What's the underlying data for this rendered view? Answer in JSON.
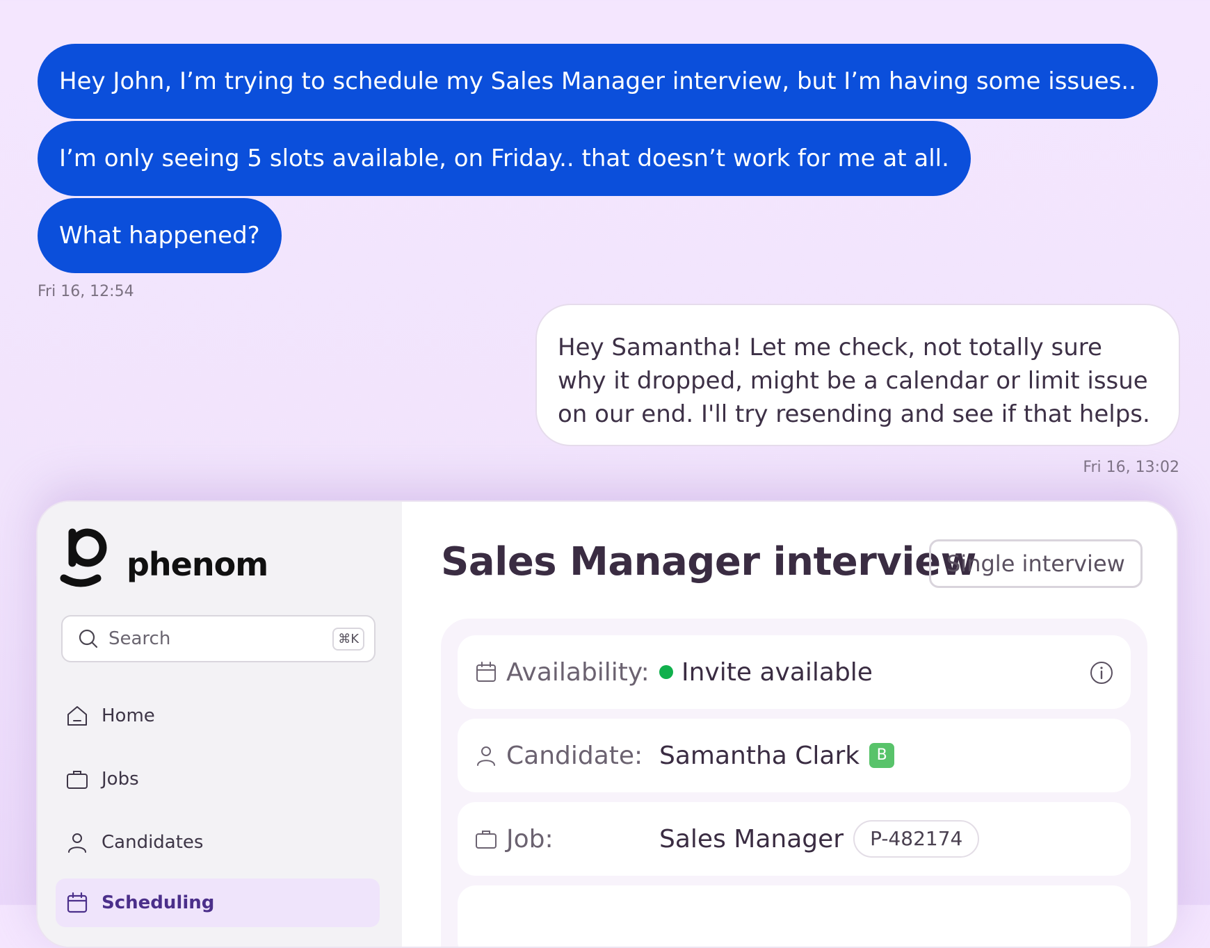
{
  "chat": {
    "incoming": [
      "Hey John, I’m trying to schedule my Sales Manager interview, but I’m having some issues..",
      "I’m only seeing 5 slots available, on Friday.. that doesn’t work for me at all.",
      "What happened?"
    ],
    "incoming_time": "Fri 16, 12:54",
    "outgoing": "Hey Samantha! Let me check, not totally sure why it dropped, might be a calendar or limit issue on our end. I'll try resending and see if that helps.",
    "outgoing_time": "Fri 16, 13:02"
  },
  "app": {
    "brand": "phenom",
    "search": {
      "placeholder": "Search",
      "shortcut": "⌘K"
    },
    "nav": {
      "home": "Home",
      "jobs": "Jobs",
      "candidates": "Candidates",
      "scheduling": "Scheduling"
    },
    "page_title": "Sales Manager interview",
    "interview_type": "Single interview",
    "details": {
      "availability_label": "Availability:",
      "availability_value": "Invite available",
      "candidate_label": "Candidate:",
      "candidate_value": "Samantha Clark",
      "candidate_tag": "B",
      "job_label": "Job:",
      "job_value": "Sales Manager",
      "job_id": "P-482174"
    }
  },
  "colors": {
    "incoming_bubble": "#0b4fdb",
    "status_available": "#10b04c",
    "candidate_tag": "#58c36a",
    "nav_active_bg": "#efe4fb"
  },
  "icons": {
    "search": "search-icon",
    "home": "home-icon",
    "jobs": "briefcase-icon",
    "candidates": "person-icon",
    "scheduling": "calendar-icon",
    "info": "info-icon"
  }
}
